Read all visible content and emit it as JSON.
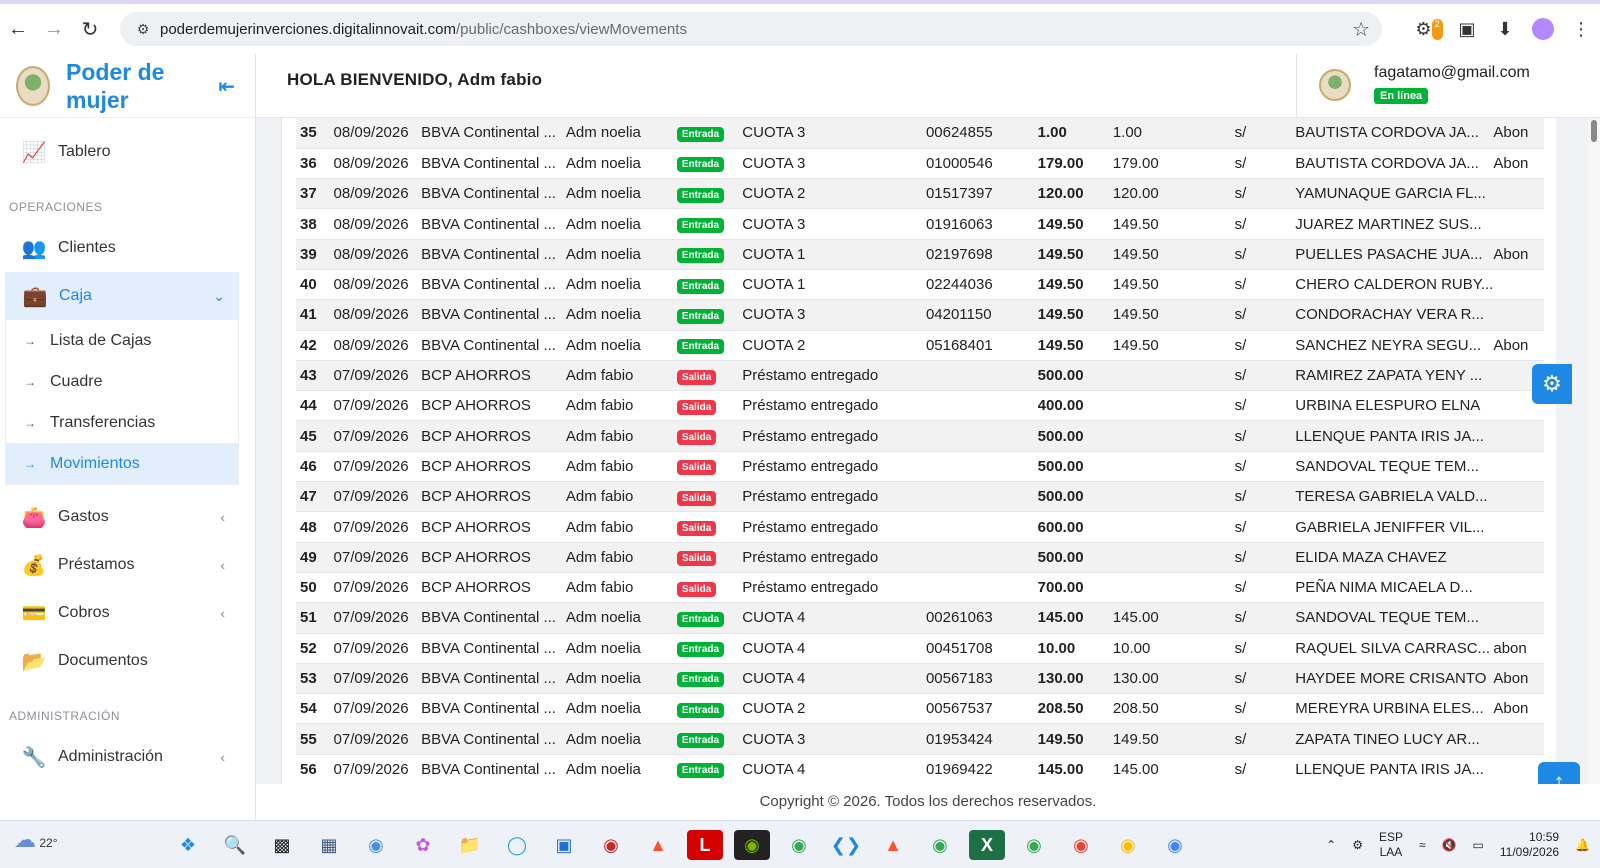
{
  "browser": {
    "url_host": "poderdemujerinverciones.digitalinnovait.com",
    "url_path": "/public/cashboxes/viewMovements",
    "extension_badge": "2"
  },
  "brand": {
    "name": "Poder de mujer"
  },
  "header": {
    "welcome": "HOLA BIENVENIDO, Adm fabio",
    "email": "fagatamo@gmail.com",
    "status": "En línea"
  },
  "sidebar": {
    "tablero": "Tablero",
    "section_ops": "OPERACIONES",
    "clientes": "Clientes",
    "caja": "Caja",
    "caja_sub": [
      "Lista de Cajas",
      "Cuadre",
      "Transferencias",
      "Movimientos"
    ],
    "gastos": "Gastos",
    "prestamos": "Préstamos",
    "cobros": "Cobros",
    "documentos": "Documentos",
    "section_admin": "ADMINISTRACIÓN",
    "administracion": "Administración"
  },
  "movements": [
    {
      "n": "35",
      "date": "08/09/2026",
      "bank": "BBVA Continental ...",
      "user": "Adm noelia",
      "type": "Entrada",
      "concept": "CUOTA 3",
      "op": "00624855",
      "amount": "1.00",
      "paid": "1.00",
      "cur": "s/",
      "client": "BAUTISTA CORDOVA JA...",
      "note": "Abon"
    },
    {
      "n": "36",
      "date": "08/09/2026",
      "bank": "BBVA Continental ...",
      "user": "Adm noelia",
      "type": "Entrada",
      "concept": "CUOTA 3",
      "op": "01000546",
      "amount": "179.00",
      "paid": "179.00",
      "cur": "s/",
      "client": "BAUTISTA CORDOVA JA...",
      "note": "Abon"
    },
    {
      "n": "37",
      "date": "08/09/2026",
      "bank": "BBVA Continental ...",
      "user": "Adm noelia",
      "type": "Entrada",
      "concept": "CUOTA 2",
      "op": "01517397",
      "amount": "120.00",
      "paid": "120.00",
      "cur": "s/",
      "client": "YAMUNAQUE GARCIA FL...",
      "note": ""
    },
    {
      "n": "38",
      "date": "08/09/2026",
      "bank": "BBVA Continental ...",
      "user": "Adm noelia",
      "type": "Entrada",
      "concept": "CUOTA 3",
      "op": "01916063",
      "amount": "149.50",
      "paid": "149.50",
      "cur": "s/",
      "client": "JUAREZ MARTINEZ SUS...",
      "note": ""
    },
    {
      "n": "39",
      "date": "08/09/2026",
      "bank": "BBVA Continental ...",
      "user": "Adm noelia",
      "type": "Entrada",
      "concept": "CUOTA 1",
      "op": "02197698",
      "amount": "149.50",
      "paid": "149.50",
      "cur": "s/",
      "client": "PUELLES PASACHE JUA...",
      "note": "Abon"
    },
    {
      "n": "40",
      "date": "08/09/2026",
      "bank": "BBVA Continental ...",
      "user": "Adm noelia",
      "type": "Entrada",
      "concept": "CUOTA 1",
      "op": "02244036",
      "amount": "149.50",
      "paid": "149.50",
      "cur": "s/",
      "client": "CHERO CALDERON RUBY...",
      "note": ""
    },
    {
      "n": "41",
      "date": "08/09/2026",
      "bank": "BBVA Continental ...",
      "user": "Adm noelia",
      "type": "Entrada",
      "concept": "CUOTA 3",
      "op": "04201150",
      "amount": "149.50",
      "paid": "149.50",
      "cur": "s/",
      "client": "CONDORACHAY VERA R...",
      "note": ""
    },
    {
      "n": "42",
      "date": "08/09/2026",
      "bank": "BBVA Continental ...",
      "user": "Adm noelia",
      "type": "Entrada",
      "concept": "CUOTA 2",
      "op": "05168401",
      "amount": "149.50",
      "paid": "149.50",
      "cur": "s/",
      "client": "SANCHEZ NEYRA SEGU...",
      "note": "Abon"
    },
    {
      "n": "43",
      "date": "07/09/2026",
      "bank": "BCP AHORROS",
      "user": "Adm fabio",
      "type": "Salida",
      "concept": "Préstamo entregado",
      "op": "",
      "amount": "500.00",
      "paid": "",
      "cur": "s/",
      "client": "RAMIREZ ZAPATA YENY ...",
      "note": ""
    },
    {
      "n": "44",
      "date": "07/09/2026",
      "bank": "BCP AHORROS",
      "user": "Adm fabio",
      "type": "Salida",
      "concept": "Préstamo entregado",
      "op": "",
      "amount": "400.00",
      "paid": "",
      "cur": "s/",
      "client": "URBINA ELESPURO ELNA",
      "note": ""
    },
    {
      "n": "45",
      "date": "07/09/2026",
      "bank": "BCP AHORROS",
      "user": "Adm fabio",
      "type": "Salida",
      "concept": "Préstamo entregado",
      "op": "",
      "amount": "500.00",
      "paid": "",
      "cur": "s/",
      "client": "LLENQUE PANTA IRIS JA...",
      "note": ""
    },
    {
      "n": "46",
      "date": "07/09/2026",
      "bank": "BCP AHORROS",
      "user": "Adm fabio",
      "type": "Salida",
      "concept": "Préstamo entregado",
      "op": "",
      "amount": "500.00",
      "paid": "",
      "cur": "s/",
      "client": "SANDOVAL TEQUE TEM...",
      "note": ""
    },
    {
      "n": "47",
      "date": "07/09/2026",
      "bank": "BCP AHORROS",
      "user": "Adm fabio",
      "type": "Salida",
      "concept": "Préstamo entregado",
      "op": "",
      "amount": "500.00",
      "paid": "",
      "cur": "s/",
      "client": "TERESA GABRIELA VALD...",
      "note": ""
    },
    {
      "n": "48",
      "date": "07/09/2026",
      "bank": "BCP AHORROS",
      "user": "Adm fabio",
      "type": "Salida",
      "concept": "Préstamo entregado",
      "op": "",
      "amount": "600.00",
      "paid": "",
      "cur": "s/",
      "client": "GABRIELA JENIFFER VIL...",
      "note": ""
    },
    {
      "n": "49",
      "date": "07/09/2026",
      "bank": "BCP AHORROS",
      "user": "Adm fabio",
      "type": "Salida",
      "concept": "Préstamo entregado",
      "op": "",
      "amount": "500.00",
      "paid": "",
      "cur": "s/",
      "client": "ELIDA MAZA CHAVEZ",
      "note": ""
    },
    {
      "n": "50",
      "date": "07/09/2026",
      "bank": "BCP AHORROS",
      "user": "Adm fabio",
      "type": "Salida",
      "concept": "Préstamo entregado",
      "op": "",
      "amount": "700.00",
      "paid": "",
      "cur": "s/",
      "client": "PEÑA NIMA MICAELA D...",
      "note": ""
    },
    {
      "n": "51",
      "date": "07/09/2026",
      "bank": "BBVA Continental ...",
      "user": "Adm noelia",
      "type": "Entrada",
      "concept": "CUOTA 4",
      "op": "00261063",
      "amount": "145.00",
      "paid": "145.00",
      "cur": "s/",
      "client": "SANDOVAL TEQUE TEM...",
      "note": ""
    },
    {
      "n": "52",
      "date": "07/09/2026",
      "bank": "BBVA Continental ...",
      "user": "Adm noelia",
      "type": "Entrada",
      "concept": "CUOTA 4",
      "op": "00451708",
      "amount": "10.00",
      "paid": "10.00",
      "cur": "s/",
      "client": "RAQUEL SILVA CARRASC...",
      "note": "abon"
    },
    {
      "n": "53",
      "date": "07/09/2026",
      "bank": "BBVA Continental ...",
      "user": "Adm noelia",
      "type": "Entrada",
      "concept": "CUOTA 4",
      "op": "00567183",
      "amount": "130.00",
      "paid": "130.00",
      "cur": "s/",
      "client": "HAYDEE MORE CRISANTO",
      "note": "Abon"
    },
    {
      "n": "54",
      "date": "07/09/2026",
      "bank": "BBVA Continental ...",
      "user": "Adm noelia",
      "type": "Entrada",
      "concept": "CUOTA 2",
      "op": "00567537",
      "amount": "208.50",
      "paid": "208.50",
      "cur": "s/",
      "client": "MEREYRA URBINA ELES...",
      "note": "Abon"
    },
    {
      "n": "55",
      "date": "07/09/2026",
      "bank": "BBVA Continental ...",
      "user": "Adm noelia",
      "type": "Entrada",
      "concept": "CUOTA 3",
      "op": "01953424",
      "amount": "149.50",
      "paid": "149.50",
      "cur": "s/",
      "client": "ZAPATA TINEO LUCY AR...",
      "note": ""
    },
    {
      "n": "56",
      "date": "07/09/2026",
      "bank": "BBVA Continental ...",
      "user": "Adm noelia",
      "type": "Entrada",
      "concept": "CUOTA 4",
      "op": "01969422",
      "amount": "145.00",
      "paid": "145.00",
      "cur": "s/",
      "client": "LLENQUE PANTA IRIS JA...",
      "note": ""
    }
  ],
  "footer": {
    "text": "Copyright © 2026. Todos los derechos reservados."
  },
  "taskbar": {
    "temperature": "22°",
    "lang_top": "ESP",
    "lang_bottom": "LAA",
    "time": "10:59",
    "date": "11/09/2026"
  }
}
